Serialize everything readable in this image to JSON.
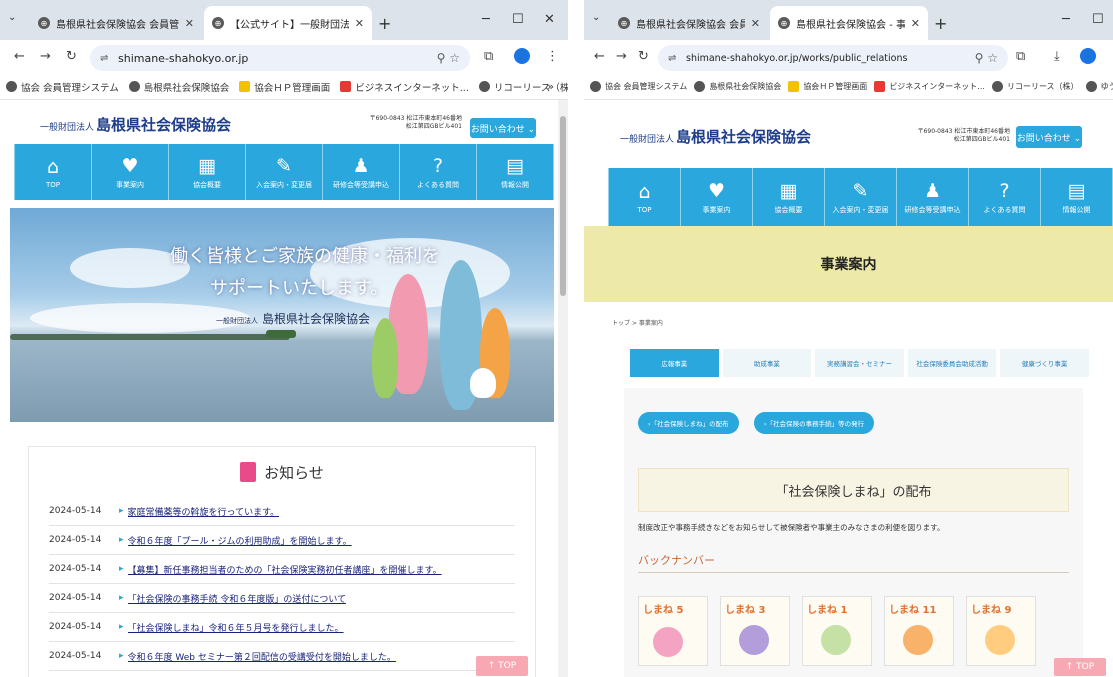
{
  "left": {
    "tabs": [
      {
        "title": "島根県社会保険協会 会員管理",
        "active": false
      },
      {
        "title": "【公式サイト】一般財団法人 島根県",
        "active": true
      }
    ],
    "url": "shimane-shahokyo.or.jp",
    "bookmarks": [
      "協会 会員管理システム",
      "島根県社会保険協会",
      "協会ＨＰ管理画面",
      "ビジネスインターネット...",
      "リコーリース（株）"
    ],
    "site": {
      "logo_small": "一般財団法人",
      "logo_big": "島根県社会保険協会",
      "postal_line1": "〒690-0843 松江市東本町46番地",
      "postal_line2": "松江第四GBビル401",
      "contact": "お問い合わせ ⌄"
    },
    "gnav": [
      {
        "label": "TOP",
        "icon": "⌂"
      },
      {
        "label": "事業案内",
        "icon": "♥"
      },
      {
        "label": "協会概要",
        "icon": "▦"
      },
      {
        "label": "入会案内・変更届",
        "icon": "✎"
      },
      {
        "label": "研修会等受講申込",
        "icon": "♟"
      },
      {
        "label": "よくある質問",
        "icon": "?"
      },
      {
        "label": "情報公開",
        "icon": "▤"
      }
    ],
    "hero": {
      "slogan1": "働く皆様とご家族の健康・福利を",
      "slogan2": "サポートいたします。",
      "org_small": "一般財団法人",
      "org_big": "島根県社会保険協会"
    },
    "news": {
      "title": "お知らせ",
      "items": [
        {
          "date": "2024-05-14",
          "text": "家庭常備薬等の斡旋を行っています。"
        },
        {
          "date": "2024-05-14",
          "text": "令和６年度「プール・ジムの利用助成」を開始します。"
        },
        {
          "date": "2024-05-14",
          "text": "【募集】新任事務担当者のための「社会保険実務初任者講座」を開催します。"
        },
        {
          "date": "2024-05-14",
          "text": "「社会保険の事務手続 令和６年度版」の送付について"
        },
        {
          "date": "2024-05-14",
          "text": "「社会保険しまね」令和６年５月号を発行しました。"
        },
        {
          "date": "2024-05-14",
          "text": "令和６年度 Web セミナー第２回配信の受講受付を開始しました。"
        }
      ]
    },
    "top_button": "↑ TOP"
  },
  "right": {
    "tabs": [
      {
        "title": "島根県社会保険協会 会員管理",
        "active": false
      },
      {
        "title": "島根県社会保険協会 - 事業案内",
        "active": true
      }
    ],
    "url": "shimane-shahokyo.or.jp/works/public_relations",
    "bookmarks": [
      "協会 会員管理システム",
      "島根県社会保険協会",
      "協会ＨＰ管理画面",
      "ビジネスインターネット...",
      "リコーリース（株）",
      "ゆうちょダイレクト | ログ..."
    ],
    "page_title": "事業案内",
    "breadcrumb": "トップ > 事業案内",
    "subtabs": [
      "広報事業",
      "助成事業",
      "実務講習会・セミナー",
      "社会保険委員会助成活動",
      "健康づくり事業"
    ],
    "pills": [
      "›「社会保険しまね」の配布",
      "›「社会保険の事務手続」等の発行"
    ],
    "section_title": "「社会保険しまね」の配布",
    "body": "制度改正や事務手続きなどをお知らせして被保険者や事業主のみなさまの利便を図ります。",
    "backnumber": "バックナンバー",
    "covers": [
      "5",
      "3",
      "1",
      "11",
      "9"
    ],
    "cover_title": "しまね",
    "top_button": "↑ TOP"
  }
}
